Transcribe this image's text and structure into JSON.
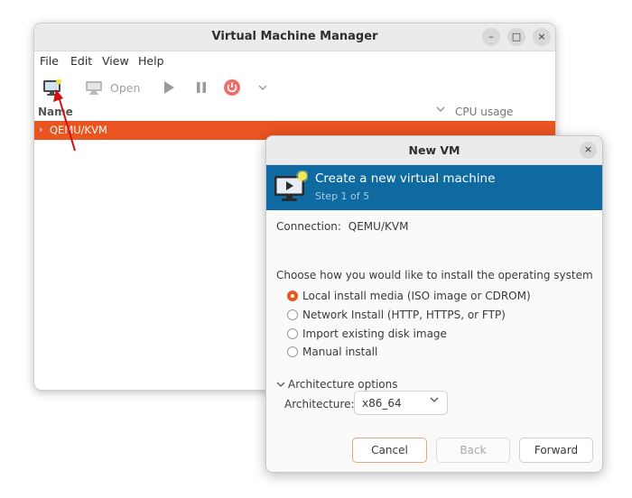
{
  "main_window": {
    "title": "Virtual Machine Manager",
    "controls": {
      "minimize": "–",
      "maximize": "□",
      "close": "×"
    },
    "menu": [
      "File",
      "Edit",
      "View",
      "Help"
    ],
    "toolbar": {
      "open_label": "Open"
    },
    "columns": {
      "name": "Name",
      "cpu": "CPU usage"
    },
    "connection_row": {
      "label": "QEMU/KVM"
    }
  },
  "dialog": {
    "title": "New VM",
    "close": "×",
    "banner": {
      "heading": "Create a new virtual machine",
      "step": "Step 1 of 5"
    },
    "connection": {
      "label": "Connection:",
      "value": "QEMU/KVM"
    },
    "install_prompt": "Choose how you would like to install the operating system",
    "install_options": [
      {
        "label": "Local install media (ISO image or CDROM)",
        "selected": true
      },
      {
        "label": "Network Install (HTTP, HTTPS, or FTP)",
        "selected": false
      },
      {
        "label": "Import existing disk image",
        "selected": false
      },
      {
        "label": "Manual install",
        "selected": false
      }
    ],
    "architecture_options": "Architecture options",
    "architecture": {
      "label": "Architecture:",
      "value": "x86_64"
    },
    "buttons": {
      "cancel": "Cancel",
      "back": "Back",
      "forward": "Forward"
    }
  },
  "colors": {
    "accent": "#e95420",
    "banner": "#0e6aa0",
    "annotation_arrow": "#d01010"
  },
  "icons": {
    "new_vm": "new-vm-icon",
    "open": "monitor-icon",
    "run": "play-icon",
    "pause": "pause-icon",
    "shutdown": "power-icon"
  }
}
